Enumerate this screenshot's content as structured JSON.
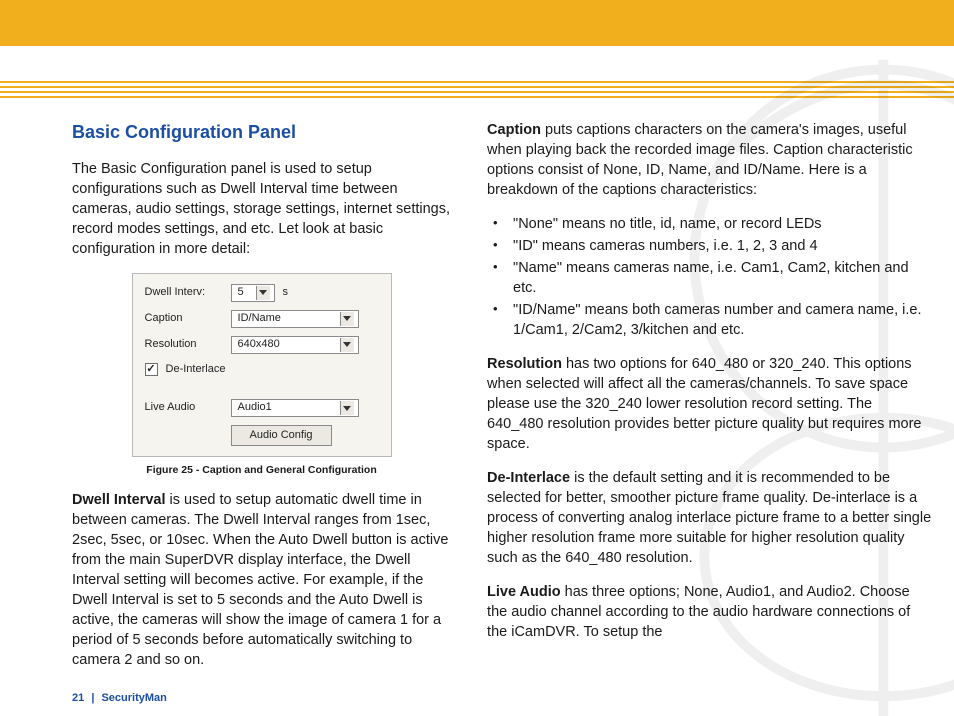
{
  "header": {
    "title": "Basic Configuration Panel"
  },
  "left": {
    "intro": "The Basic Configuration   panel is used to setup configurations such as Dwell Interval time between cameras, audio settings, storage settings, internet settings, record modes settings, and etc. Let look at basic configuration in more detail:",
    "figure": {
      "labels": {
        "dwell": "Dwell Interv:",
        "caption": "Caption",
        "resolution": "Resolution",
        "deinterlace": "De-Interlace",
        "live_audio": "Live Audio",
        "button": "Audio Config"
      },
      "values": {
        "dwell": "5",
        "dwell_unit": "s",
        "caption": "ID/Name",
        "resolution": "640x480",
        "live_audio": "Audio1"
      },
      "caption": "Figure 25 - Caption and General Configuration"
    },
    "dwell_label": "Dwell Interval",
    "dwell_text": " is used to setup automatic dwell time in between cameras.  The Dwell Interval ranges from 1sec, 2sec, 5sec, or 10sec.  When the Auto Dwell button is active from the main SuperDVR display interface, the Dwell Interval setting will becomes active.  For example, if the Dwell Interval is set to 5 seconds and the Auto Dwell is active, the cameras will show the image of camera 1 for a period of 5 seconds before automatically switching to camera 2 and so on."
  },
  "right": {
    "caption_label": "Caption",
    "caption_text": " puts captions characters on the camera's images, useful when playing back the recorded image files. Caption characteristic options consist of None, ID, Name, and ID/Name. Here is a breakdown of the captions characteristics:",
    "bullets": [
      "\"None\" means no title, id, name, or record LEDs",
      "\"ID\" means cameras numbers, i.e. 1, 2, 3 and 4",
      "\"Name\" means cameras name, i.e. Cam1, Cam2, kitchen and etc.",
      "\"ID/Name\" means both cameras number and camera name, i.e. 1/Cam1, 2/Cam2, 3/kitchen and etc."
    ],
    "resolution_label": "Resolution",
    "resolution_text": " has two options for 640_480 or 320_240.  This options when selected will affect all the cameras/channels. To save space please use the 320_240 lower resolution record setting. The 640_480 resolution provides better picture quality but requires more space.",
    "deinterlace_label": "De-Interlace",
    "deinterlace_text": " is the default setting and it is recommended to be selected for better, smoother picture frame quality.  De-interlace is a process of converting analog interlace picture frame to a better single higher resolution frame more suitable for higher resolution quality such as the 640_480 resolution.",
    "liveaudio_label": "Live Audio",
    "liveaudio_text": " has three options; None, Audio1, and Audio2. Choose the audio channel according to the audio hardware connections of the iCamDVR.  To setup the"
  },
  "footer": {
    "page": "21",
    "sep": "|",
    "brand": "SecurityMan"
  }
}
